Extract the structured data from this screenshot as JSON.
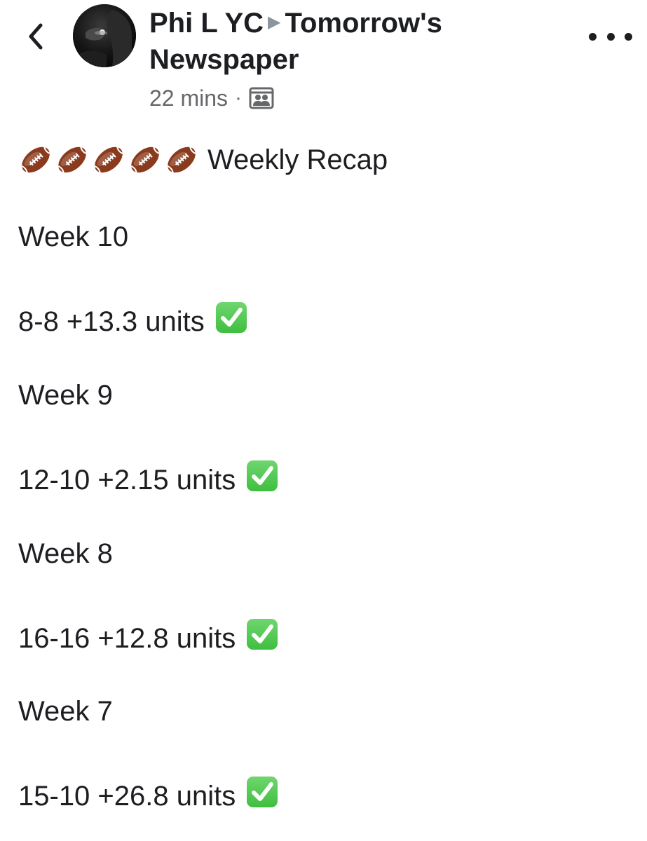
{
  "header": {
    "author": "Phi L YC",
    "separator_icon": "right-triangle-icon",
    "group": "Tomorrow's",
    "group_line2": "Newspaper",
    "time": "22 mins",
    "meta_dot": "·",
    "audience_icon": "group-audience-icon",
    "back_icon": "chevron-left-icon",
    "more_icon": "more-dots-icon"
  },
  "post": {
    "heading_emoji_count": 5,
    "heading_emoji": "american-football-icon",
    "heading": "Weekly Recap",
    "entries": [
      {
        "week": "Week 10",
        "result": "8-8 +13.3 units",
        "icon": "check-mark-button-icon"
      },
      {
        "week": "Week 9",
        "result": "12-10 +2.15 units",
        "icon": "check-mark-button-icon"
      },
      {
        "week": "Week 8",
        "result": "16-16 +12.8 units",
        "icon": "check-mark-button-icon"
      },
      {
        "week": "Week 7",
        "result": "15-10 +26.8 units",
        "icon": "check-mark-button-icon"
      }
    ]
  },
  "colors": {
    "text": "#1c1e21",
    "secondary": "#65676b",
    "check_green": "#3fbf3f",
    "football_brown": "#8a3b1d"
  }
}
